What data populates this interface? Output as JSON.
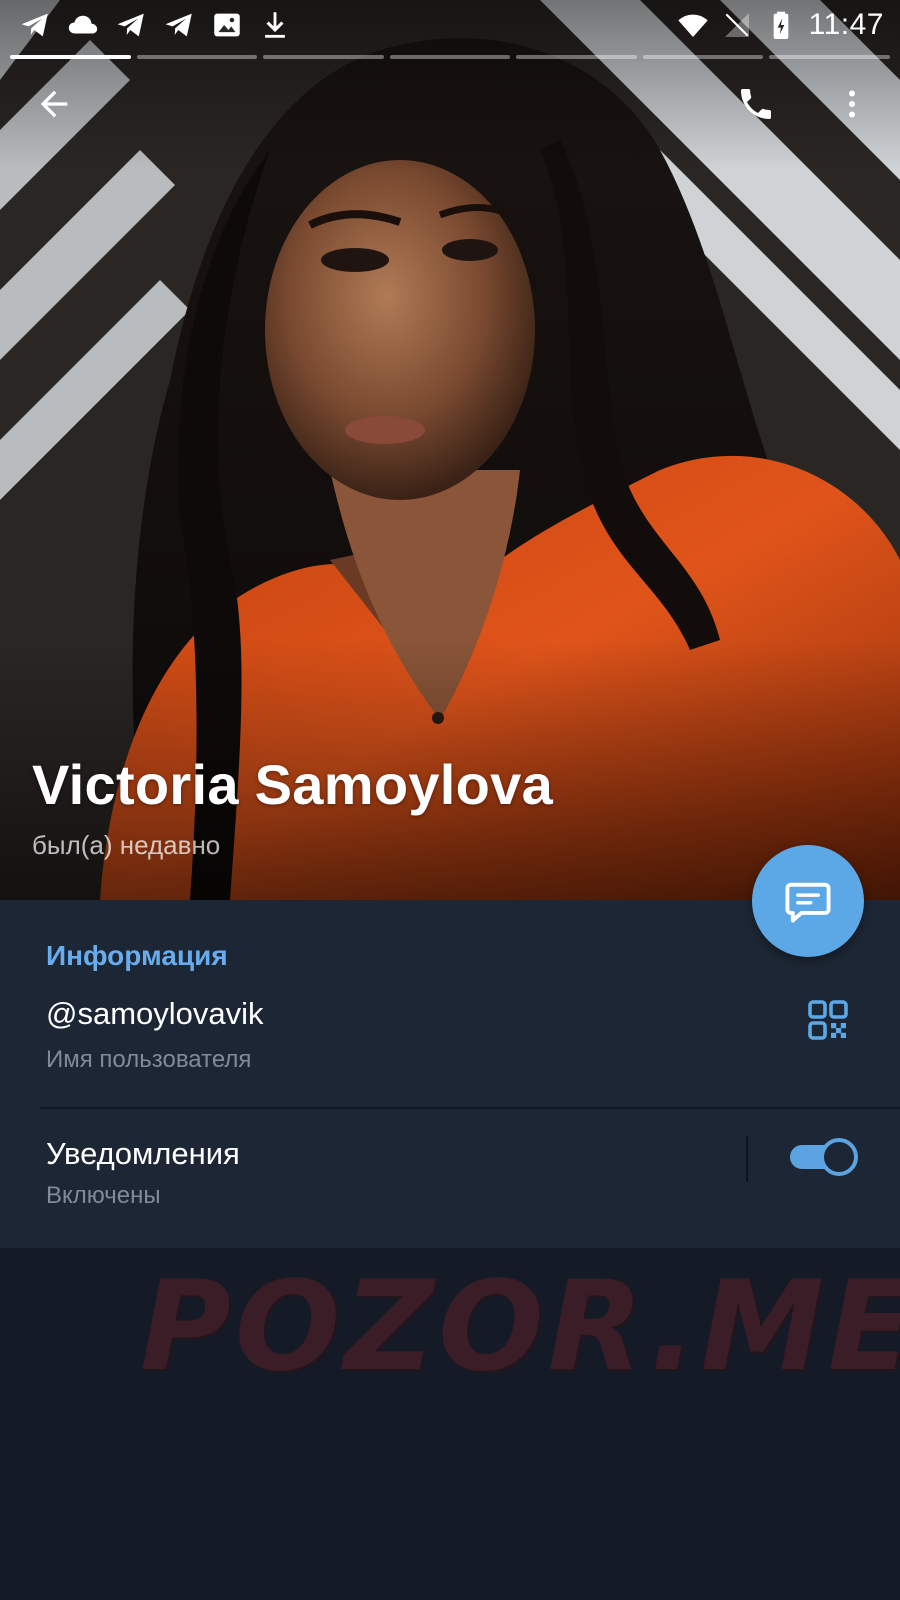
{
  "status_bar": {
    "time": "11:47",
    "left_icons": [
      "telegram-icon",
      "cloud-icon",
      "telegram-icon",
      "telegram-icon",
      "image-icon",
      "download-icon"
    ],
    "right_icons": [
      "wifi-icon",
      "signal-icon",
      "battery-charging-icon"
    ]
  },
  "stories": {
    "count": 7,
    "active_index": 0
  },
  "toolbar": {
    "back": "back-arrow-icon",
    "call": "phone-icon",
    "menu": "more-vert-icon"
  },
  "profile": {
    "name": "Victoria Samoylova",
    "status": "был(а) недавно"
  },
  "info": {
    "section_title": "Информация",
    "username": "@samoylovavik",
    "username_label": "Имя пользователя",
    "notifications_title": "Уведомления",
    "notifications_value": "Включены",
    "notifications_enabled": true
  },
  "watermark": "POZOR.ME",
  "colors": {
    "accent": "#68acee",
    "fab": "#5ca8e6",
    "panel_bg": "#1d2634",
    "page_bg": "#151b26"
  }
}
